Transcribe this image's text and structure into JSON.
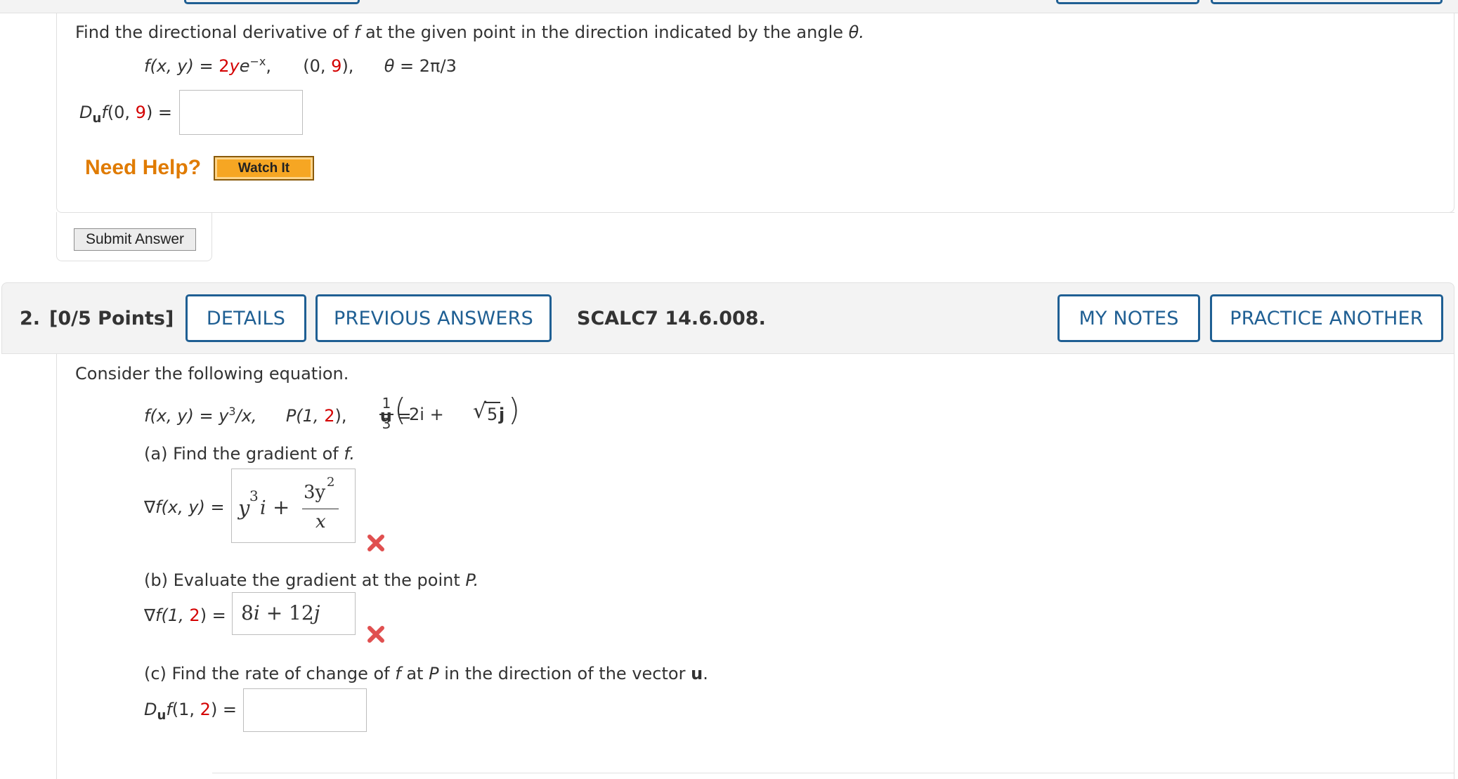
{
  "problem1": {
    "prompt_text": "Find the directional derivative of",
    "prompt_f": "f",
    "prompt_rest": "at the given point in the direction indicated by the angle",
    "prompt_theta": "θ.",
    "function_lhs": "f(x, y) = ",
    "function_coef": "2",
    "function_y": "y",
    "function_e": "e",
    "function_exp": "−x",
    "function_comma": ",",
    "point_open": "(0, ",
    "point_y": "9",
    "point_close": "),",
    "angle_theta": "θ",
    "angle_eq": " = 2π/3",
    "answer_label_D": "D",
    "answer_label_u": "u",
    "answer_label_f": "f",
    "answer_label_open": "(0, ",
    "answer_label_val": "9",
    "answer_label_close": ") =",
    "answer_value": "",
    "need_help": "Need Help?",
    "watch_it": "Watch It",
    "submit_answer": "Submit Answer"
  },
  "problem2": {
    "number": "2.",
    "points": "[0/5 Points]",
    "details_button": "DETAILS",
    "previous_answers_button": "PREVIOUS ANSWERS",
    "code": "SCALC7 14.6.008.",
    "my_notes_button": "MY NOTES",
    "practice_another_button": "PRACTICE ANOTHER",
    "intro": "Consider the following equation.",
    "eq_f": "f(x, y) = y",
    "eq_exp": "3",
    "eq_rest": "/x,",
    "eq_P_open": "P(1, ",
    "eq_P_val": "2",
    "eq_P_close": "),",
    "eq_u": "u",
    "eq_u_eq": " = ",
    "frac_num": "1",
    "frac_den": "3",
    "vec_open": "(",
    "vec_a": "2i + ",
    "vec_sqrt_arg": "5",
    "vec_j": "j",
    "vec_close": ")",
    "part_a": "(a) Find the gradient of",
    "part_a_f": "f.",
    "grad_label": "∇f(x, y) = ",
    "grad_answer_y": "y",
    "grad_answer_exp": "3",
    "grad_answer_i": "i",
    "grad_answer_plus": "+",
    "grad_frac_num": "3y",
    "grad_frac_num_exp": "2",
    "grad_frac_den": "x",
    "part_b_text": "(b) Evaluate the gradient at the point",
    "part_b_P": "P.",
    "eval_label_open": "∇f(1, ",
    "eval_label_val": "2",
    "eval_label_close": ") = ",
    "eval_answer_a": "8",
    "eval_answer_i": "i",
    "eval_answer_plus": " + 12",
    "eval_answer_j": "j",
    "part_c_text1": "(c) Find the rate of change of",
    "part_c_f": "f",
    "part_c_text2": "at",
    "part_c_P": "P",
    "part_c_text3": "in the direction of the vector",
    "part_c_u": "u",
    "part_c_period": ".",
    "rate_label_D": "D",
    "rate_label_u": "u",
    "rate_label_f": "f",
    "rate_label_open": "(1, ",
    "rate_label_val": "2",
    "rate_label_close": ") =",
    "rate_answer": ""
  },
  "colors": {
    "accent_blue": "#1f5f93",
    "incorrect_red": "#e05050",
    "help_orange": "#e07b00",
    "watch_btn": "#f6a623"
  }
}
